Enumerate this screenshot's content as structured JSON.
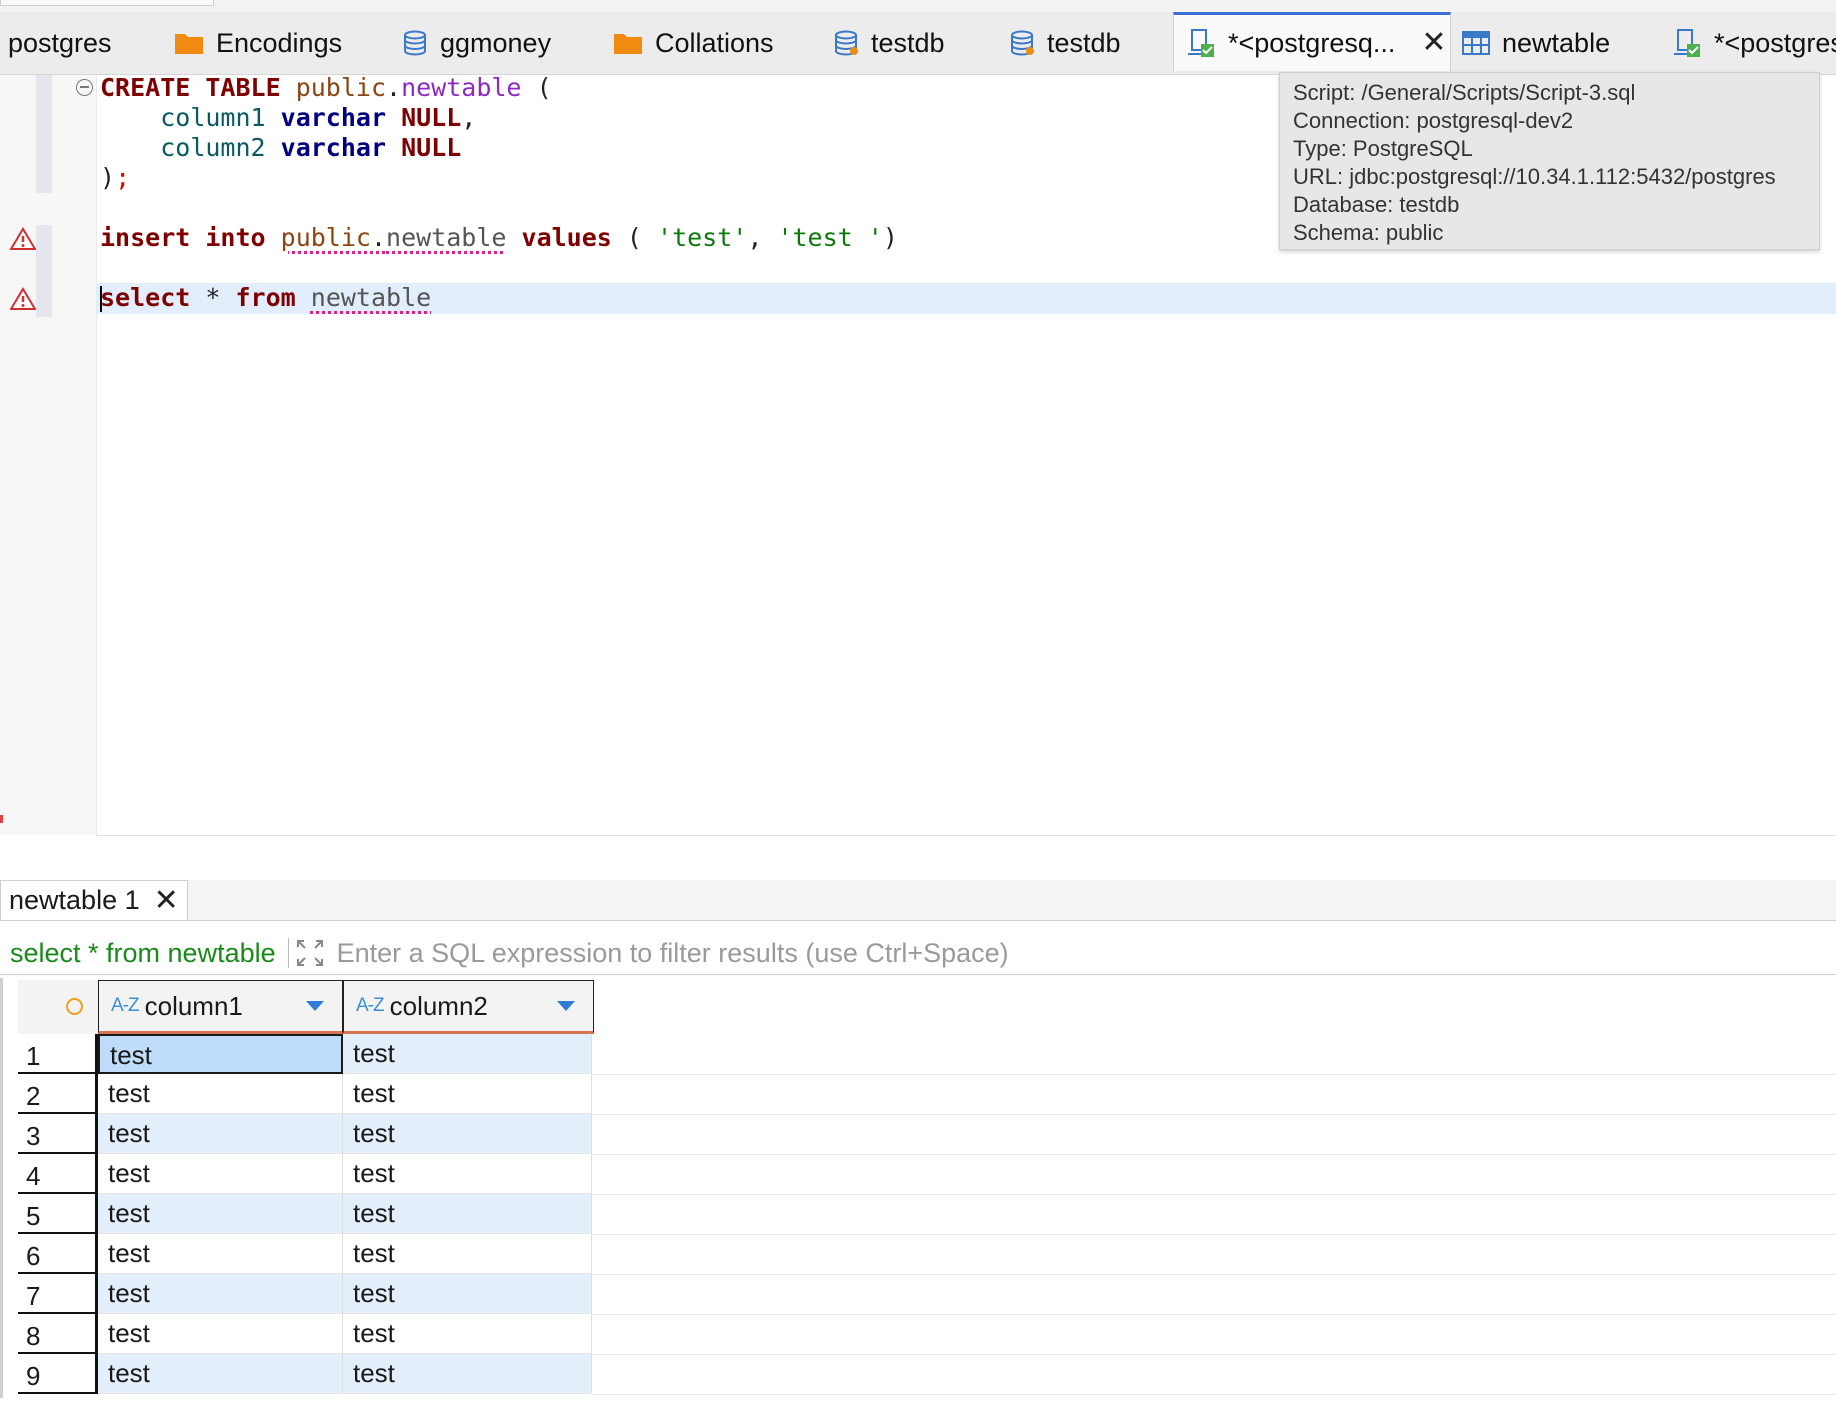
{
  "tabs": [
    {
      "label": "postgres",
      "icon": "none"
    },
    {
      "label": "Encodings",
      "icon": "folder-icon"
    },
    {
      "label": "ggmoney",
      "icon": "database-icon"
    },
    {
      "label": "Collations",
      "icon": "folder-icon"
    },
    {
      "label": "testdb",
      "icon": "database-icon"
    },
    {
      "label": "testdb",
      "icon": "database-icon"
    },
    {
      "label": "*<postgresq...",
      "icon": "sql-script-icon",
      "active": true
    },
    {
      "label": "newtable",
      "icon": "table-icon"
    },
    {
      "label": "*<postgres",
      "icon": "sql-script-icon"
    }
  ],
  "editor": {
    "create_kw": "CREATE",
    "table_kw": "TABLE",
    "schema": "public",
    "dot": ".",
    "table": "newtable",
    "open_paren": "(",
    "col1": "column1",
    "col2": "column2",
    "type": "varchar",
    "null_kw": "NULL",
    "comma": ",",
    "close": ")",
    "semicolon": ";",
    "insert_kw": "insert",
    "into_kw": "into",
    "values_kw": "values",
    "paren_open_sp": "(",
    "str1": "'test'",
    "str2": "'test '",
    "paren_close": ")",
    "select_kw": "select",
    "star": "*",
    "from_kw": "from",
    "select_table": "newtable"
  },
  "tooltip": {
    "script": "Script: /General/Scripts/Script-3.sql",
    "connection": "Connection: postgresql-dev2",
    "type": "Type: PostgreSQL",
    "url": "URL: jdbc:postgresql://10.34.1.112:5432/postgres",
    "database": "Database: testdb",
    "schema": "Schema: public"
  },
  "results": {
    "tab_label": "newtable 1",
    "query": "select * from newtable",
    "filter_placeholder": "Enter a SQL expression to filter results (use Ctrl+Space)",
    "az_label": "A-Z",
    "columns": [
      "column1",
      "column2"
    ],
    "rows": [
      {
        "n": "1",
        "c1": "test",
        "c2": "test"
      },
      {
        "n": "2",
        "c1": "test",
        "c2": "test"
      },
      {
        "n": "3",
        "c1": "test",
        "c2": "test"
      },
      {
        "n": "4",
        "c1": "test",
        "c2": "test"
      },
      {
        "n": "5",
        "c1": "test",
        "c2": "test"
      },
      {
        "n": "6",
        "c1": "test",
        "c2": "test"
      },
      {
        "n": "7",
        "c1": "test",
        "c2": "test"
      },
      {
        "n": "8",
        "c1": "test",
        "c2": "test"
      },
      {
        "n": "9",
        "c1": "test",
        "c2": "test"
      }
    ]
  },
  "colors": {
    "active_tab_accent": "#3c6fd1",
    "keyword": "#7f0000",
    "string": "#0a7a0a",
    "selected_cell": "#bfdcfa",
    "alt_row": "#e4effc"
  }
}
